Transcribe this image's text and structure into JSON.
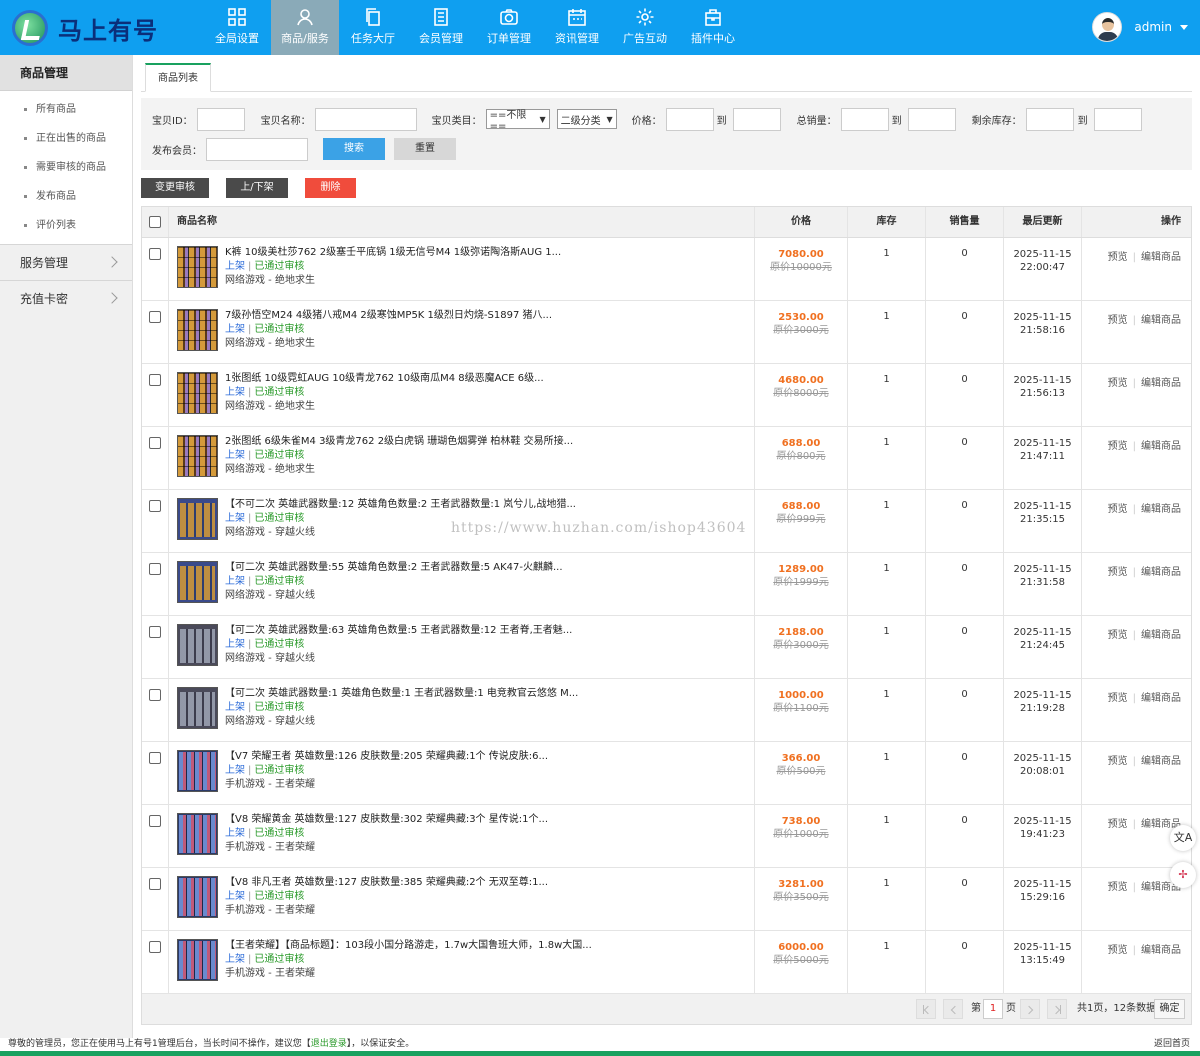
{
  "brand": {
    "name": "马上有号"
  },
  "nav": [
    {
      "label": "全局设置",
      "icon": "grid-icon"
    },
    {
      "label": "商品/服务",
      "icon": "user-icon",
      "active": true
    },
    {
      "label": "任务大厅",
      "icon": "copy-icon"
    },
    {
      "label": "会员管理",
      "icon": "list-icon"
    },
    {
      "label": "订单管理",
      "icon": "camera-icon"
    },
    {
      "label": "资讯管理",
      "icon": "calendar-icon"
    },
    {
      "label": "广告互动",
      "icon": "gear-icon"
    },
    {
      "label": "插件中心",
      "icon": "bag-icon"
    }
  ],
  "user": {
    "name": "admin"
  },
  "sidebar": {
    "title": "商品管理",
    "items": [
      "所有商品",
      "正在出售的商品",
      "需要审核的商品",
      "发布商品",
      "评价列表"
    ],
    "groups": [
      "服务管理",
      "充值卡密"
    ]
  },
  "tab": "商品列表",
  "filter": {
    "id_label": "宝贝ID：",
    "name_label": "宝贝名称：",
    "cat_label": "宝贝类目：",
    "cat1": "==不限==",
    "cat2": "二级分类",
    "price_label": "价格：",
    "to": "到",
    "sales_label": "总销量：",
    "stock_label": "剩余库存：",
    "member_label": "发布会员：",
    "search": "搜索",
    "reset": "重置"
  },
  "actions": [
    "变更审核",
    "上/下架",
    "删除"
  ],
  "colors": {
    "topbar": "#0f9ff0",
    "nav_active": "#8aaab8",
    "accent_green": "#19a15f",
    "price": "#f07020",
    "delete": "#f04c3c",
    "dark_btn": "#4a4a4a",
    "search_btn": "#3ba2e6"
  },
  "table": {
    "headers": {
      "name": "商品名称",
      "price": "价格",
      "stock": "库存",
      "sales": "销售量",
      "updated": "最后更新",
      "ops": "操作"
    },
    "status_on": "上架",
    "status_ok": "已通过审核",
    "op_preview": "预览",
    "op_edit": "编辑商品",
    "rows": [
      {
        "title": "K裤 10级美杜莎762 2级塞壬平底锅 1级无信号M4 1级弥诺陶洛斯AUG 1...",
        "cat": "网络游戏 - 绝地求生",
        "price": "7080.00",
        "old": "原价10000元",
        "stock": "1",
        "sales": "0",
        "date": "2025-11-15",
        "time": "22:00:47",
        "thumb": "t1"
      },
      {
        "title": "7级孙悟空M24 4级猪八戒M4 2级寒蚀MP5K 1级烈日灼烧-S1897 猪八...",
        "cat": "网络游戏 - 绝地求生",
        "price": "2530.00",
        "old": "原价3000元",
        "stock": "1",
        "sales": "0",
        "date": "2025-11-15",
        "time": "21:58:16",
        "thumb": "t1"
      },
      {
        "title": "1张图纸 10级霓虹AUG 10级青龙762 10级南瓜M4 8级恶魔ACE 6级...",
        "cat": "网络游戏 - 绝地求生",
        "price": "4680.00",
        "old": "原价8000元",
        "stock": "1",
        "sales": "0",
        "date": "2025-11-15",
        "time": "21:56:13",
        "thumb": "t1"
      },
      {
        "title": "2张图纸 6级朱雀M4 3级青龙762 2级白虎锅 珊瑚色烟雾弹 柏林鞋 交易所接...",
        "cat": "网络游戏 - 绝地求生",
        "price": "688.00",
        "old": "原价800元",
        "stock": "1",
        "sales": "0",
        "date": "2025-11-15",
        "time": "21:47:11",
        "thumb": "t1"
      },
      {
        "title": "【不可二次 英雄武器数量:12 英雄角色数量:2 王者武器数量:1 岚兮儿,战地猎...",
        "cat": "网络游戏 - 穿越火线",
        "price": "688.00",
        "old": "原价999元",
        "stock": "1",
        "sales": "0",
        "date": "2025-11-15",
        "time": "21:35:15",
        "thumb": "t2"
      },
      {
        "title": "【可二次 英雄武器数量:55 英雄角色数量:2 王者武器数量:5 AK47-火麒麟...",
        "cat": "网络游戏 - 穿越火线",
        "price": "1289.00",
        "old": "原价1999元",
        "stock": "1",
        "sales": "0",
        "date": "2025-11-15",
        "time": "21:31:58",
        "thumb": "t2"
      },
      {
        "title": "【可二次 英雄武器数量:63 英雄角色数量:5 王者武器数量:12 王者脊,王者魅...",
        "cat": "网络游戏 - 穿越火线",
        "price": "2188.00",
        "old": "原价3000元",
        "stock": "1",
        "sales": "0",
        "date": "2025-11-15",
        "time": "21:24:45",
        "thumb": "t3"
      },
      {
        "title": "【可二次 英雄武器数量:1 英雄角色数量:1 王者武器数量:1 电竞教官云悠悠 M...",
        "cat": "网络游戏 - 穿越火线",
        "price": "1000.00",
        "old": "原价1100元",
        "stock": "1",
        "sales": "0",
        "date": "2025-11-15",
        "time": "21:19:28",
        "thumb": "t3"
      },
      {
        "title": "【V7 荣耀王者 英雄数量:126 皮肤数量:205 荣耀典藏:1个 传说皮肤:6...",
        "cat": "手机游戏 - 王者荣耀",
        "price": "366.00",
        "old": "原价500元",
        "stock": "1",
        "sales": "0",
        "date": "2025-11-15",
        "time": "20:08:01",
        "thumb": "t4"
      },
      {
        "title": "【V8 荣耀黄金 英雄数量:127 皮肤数量:302 荣耀典藏:3个 星传说:1个...",
        "cat": "手机游戏 - 王者荣耀",
        "price": "738.00",
        "old": "原价1000元",
        "stock": "1",
        "sales": "0",
        "date": "2025-11-15",
        "time": "19:41:23",
        "thumb": "t4"
      },
      {
        "title": "【V8 非凡王者 英雄数量:127 皮肤数量:385 荣耀典藏:2个 无双至尊:1...",
        "cat": "手机游戏 - 王者荣耀",
        "price": "3281.00",
        "old": "原价3500元",
        "stock": "1",
        "sales": "0",
        "date": "2025-11-15",
        "time": "15:29:16",
        "thumb": "t4"
      },
      {
        "title": "【王者荣耀】【商品标题】：103段小国分路游走，1.7w大国鲁班大师，1.8w大国...",
        "cat": "手机游戏 - 王者荣耀",
        "price": "6000.00",
        "old": "原价5000元",
        "stock": "1",
        "sales": "0",
        "date": "2025-11-15",
        "time": "13:15:49",
        "thumb": "t4"
      }
    ]
  },
  "pager": {
    "page_prefix": "第",
    "page": "1",
    "page_suffix": "页",
    "summary": "共1页，12条数据",
    "go": "确定"
  },
  "watermark": "https://www.huzhan.com/ishop43604",
  "footer": {
    "text1": "尊敬的管理员，您正在使用马上有号1管理后台，当长时间不操作，建议您【",
    "logout": "退出登录",
    "text2": "】，以保证安全。",
    "home": "返回首页"
  },
  "floats": {
    "translate": "文A",
    "plugin": "✢"
  }
}
